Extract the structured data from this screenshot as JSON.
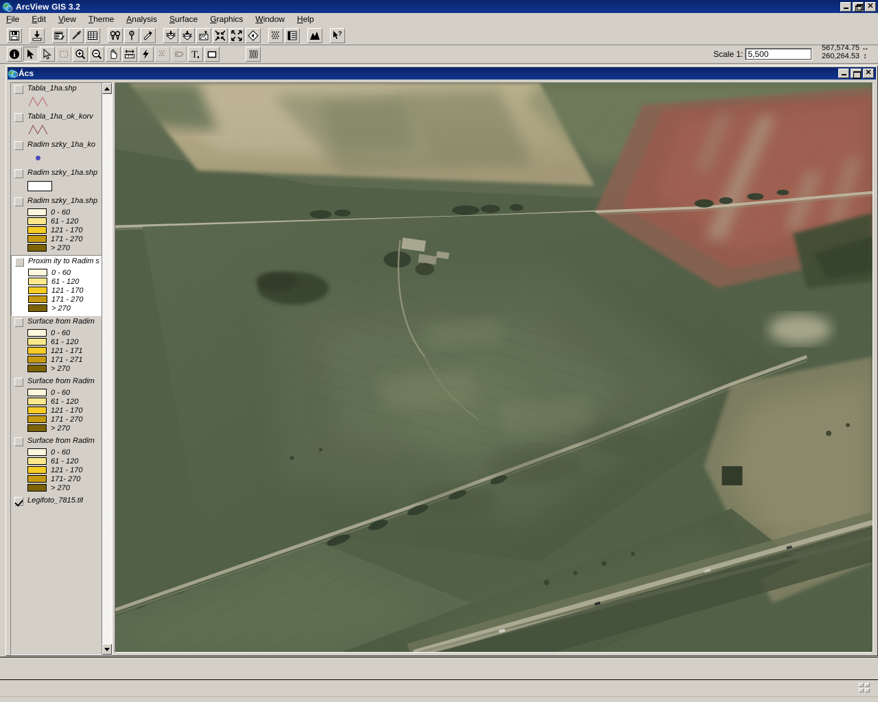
{
  "app": {
    "title": "ArcView GIS 3.2",
    "icon": "arcview-globe-icon",
    "window_controls": {
      "minimize": "_",
      "restore": "❐",
      "close": "✕"
    }
  },
  "menubar": {
    "items": [
      {
        "label": "File",
        "accel": "F"
      },
      {
        "label": "Edit",
        "accel": "E"
      },
      {
        "label": "View",
        "accel": "V"
      },
      {
        "label": "Theme",
        "accel": "T"
      },
      {
        "label": "Analysis",
        "accel": "A"
      },
      {
        "label": "Surface",
        "accel": "S"
      },
      {
        "label": "Graphics",
        "accel": "G"
      },
      {
        "label": "Window",
        "accel": "W"
      },
      {
        "label": "Help",
        "accel": "H"
      }
    ]
  },
  "toolbar_main": {
    "buttons": [
      {
        "name": "save-project-button",
        "icon": "floppy-disk-icon",
        "enabled": true
      },
      {
        "name": "add-theme-button",
        "icon": "add-theme-icon",
        "enabled": true
      },
      {
        "name": "theme-properties-button",
        "icon": "theme-properties-icon",
        "enabled": true
      },
      {
        "name": "edit-legend-button",
        "icon": "legend-editor-icon",
        "enabled": true
      },
      {
        "name": "open-table-button",
        "icon": "table-icon",
        "enabled": true
      },
      {
        "name": "find-button",
        "icon": "binoculars-icon",
        "enabled": true
      },
      {
        "name": "locate-address-button",
        "icon": "locate-address-icon",
        "enabled": true
      },
      {
        "name": "query-builder-button",
        "icon": "hammer-query-icon",
        "enabled": true
      },
      {
        "name": "zoom-to-selected-button",
        "icon": "zoom-selected-icon",
        "enabled": true
      },
      {
        "name": "clear-selection-button",
        "icon": "clear-selection-icon",
        "enabled": true
      },
      {
        "name": "select-feature-button",
        "icon": "select-feature-icon",
        "enabled": true
      },
      {
        "name": "zoom-to-themes-button",
        "icon": "zoom-in-arrows-icon",
        "enabled": true
      },
      {
        "name": "zoom-to-full-extent-button",
        "icon": "zoom-out-arrows-icon",
        "enabled": true
      },
      {
        "name": "zoom-previous-button",
        "icon": "zoom-previous-icon",
        "enabled": true
      },
      {
        "name": "zoom-to-active-theme-button",
        "icon": "zoom-active-theme-icon",
        "enabled": true
      },
      {
        "name": "open-legend-button",
        "icon": "legend-panel-icon",
        "enabled": true
      },
      {
        "name": "create-chart-button",
        "icon": "histogram-icon",
        "enabled": true
      },
      {
        "name": "help-pointer-button",
        "icon": "help-arrow-icon",
        "enabled": true
      }
    ]
  },
  "toolbar_tools": {
    "buttons": [
      {
        "name": "identify-tool",
        "icon": "info-circle-icon",
        "enabled": true,
        "pressed": false
      },
      {
        "name": "pointer-tool",
        "icon": "arrow-pointer-icon",
        "enabled": true,
        "pressed": true
      },
      {
        "name": "vertex-edit-tool",
        "icon": "vertex-arrow-icon",
        "enabled": true,
        "pressed": false
      },
      {
        "name": "select-shape-tool",
        "icon": "marquee-select-icon",
        "enabled": false,
        "pressed": false
      },
      {
        "name": "zoom-in-tool",
        "icon": "magnifier-plus-icon",
        "enabled": true,
        "pressed": false
      },
      {
        "name": "zoom-out-tool",
        "icon": "magnifier-minus-icon",
        "enabled": true,
        "pressed": false
      },
      {
        "name": "pan-tool",
        "icon": "hand-pan-icon",
        "enabled": true,
        "pressed": false
      },
      {
        "name": "measure-tool",
        "icon": "ruler-measure-icon",
        "enabled": true,
        "pressed": false
      },
      {
        "name": "hot-link-tool",
        "icon": "lightning-bolt-icon",
        "enabled": true,
        "pressed": false
      },
      {
        "name": "area-of-interest-tool",
        "icon": "dotted-area-icon",
        "enabled": false,
        "pressed": false
      },
      {
        "name": "label-tool",
        "icon": "label-tag-icon",
        "enabled": false,
        "pressed": false
      },
      {
        "name": "text-tool",
        "icon": "text-t-icon",
        "enabled": true,
        "pressed": false
      },
      {
        "name": "draw-rectangle-tool",
        "icon": "rectangle-draw-icon",
        "enabled": true,
        "pressed": false
      },
      {
        "name": "image-analysis-tool",
        "icon": "image-analysis-icon",
        "enabled": true,
        "pressed": false
      }
    ]
  },
  "scale": {
    "label": "Scale 1:",
    "value": "5,500",
    "placeholder": "5,500"
  },
  "coordinates": {
    "x": "567,574.75",
    "y": "260,264.53",
    "x_glyph": "↔",
    "y_glyph": "↕"
  },
  "view_window": {
    "title": "Ács",
    "icon": "view-globe-icon",
    "window_controls": {
      "minimize": "_",
      "maximize": "□",
      "close": "✕"
    }
  },
  "legend": {
    "ramp_colors": [
      "#fdf7dd",
      "#fbe88c",
      "#f7cb26",
      "#c59a12",
      "#7d6308"
    ],
    "themes": [
      {
        "name": "Tabla_1ha.shp",
        "checked": false,
        "selected": false,
        "symbol": "zigzag-line",
        "symbol_color": "#c07f7f",
        "classes": []
      },
      {
        "name": "Tabla_1ha_ok_korv",
        "checked": false,
        "selected": false,
        "symbol": "zigzag-line",
        "symbol_color": "#9c6a6a",
        "classes": []
      },
      {
        "name": "Radim szky_1ha_ko",
        "checked": false,
        "selected": false,
        "symbol": "point-dot",
        "symbol_color": "#4b4bbf",
        "classes": []
      },
      {
        "name": "Radim szky_1ha.shp",
        "checked": false,
        "selected": false,
        "symbol": "hollow-rectangle",
        "symbol_color": "#ffffff",
        "classes": []
      },
      {
        "name": "Radim szky_1ha.shp",
        "checked": false,
        "selected": false,
        "symbol": "graduated-ramp",
        "classes": [
          "0 - 60",
          "61 - 120",
          "121 - 170",
          "171 - 270",
          "> 270"
        ]
      },
      {
        "name": "Proxim ity to Radim s",
        "checked": false,
        "selected": true,
        "symbol": "graduated-ramp",
        "classes": [
          "0 - 60",
          "61 - 120",
          "121 - 170",
          "171 - 270",
          "> 270"
        ]
      },
      {
        "name": "Surface from Radim",
        "checked": false,
        "selected": false,
        "symbol": "graduated-ramp",
        "classes": [
          "0 - 60",
          "61 - 120",
          "121 - 171",
          "171 - 271",
          "> 270"
        ]
      },
      {
        "name": "Surface from Radim",
        "checked": false,
        "selected": false,
        "symbol": "graduated-ramp",
        "classes": [
          "0 - 60",
          "61 - 120",
          "121 - 170",
          "171 - 270",
          "> 270"
        ]
      },
      {
        "name": "Surface from Radim",
        "checked": false,
        "selected": false,
        "symbol": "graduated-ramp",
        "classes": [
          "0 - 60",
          "61 - 120",
          "121 - 170",
          "171- 270",
          "> 270"
        ]
      },
      {
        "name": "Legifoto_7815.tif",
        "checked": true,
        "selected": false,
        "symbol": "none",
        "classes": []
      }
    ]
  },
  "map": {
    "theme_displayed": "Legifoto_7815.tif",
    "description": "aerial orthophoto of agricultural fields",
    "colors": {
      "field_green_dark": "#3f5137",
      "field_green_mid": "#54664a",
      "field_green_light": "#6d7d5e",
      "field_tan": "#b9ac84",
      "field_tan_light": "#cdc1a0",
      "red_crop": "#9e5c4e",
      "road_light": "#c9c3ae",
      "tree_dark": "#2c3a27"
    }
  },
  "status_bar": {
    "message": "",
    "resize_grip": "grid-resize-icon"
  }
}
